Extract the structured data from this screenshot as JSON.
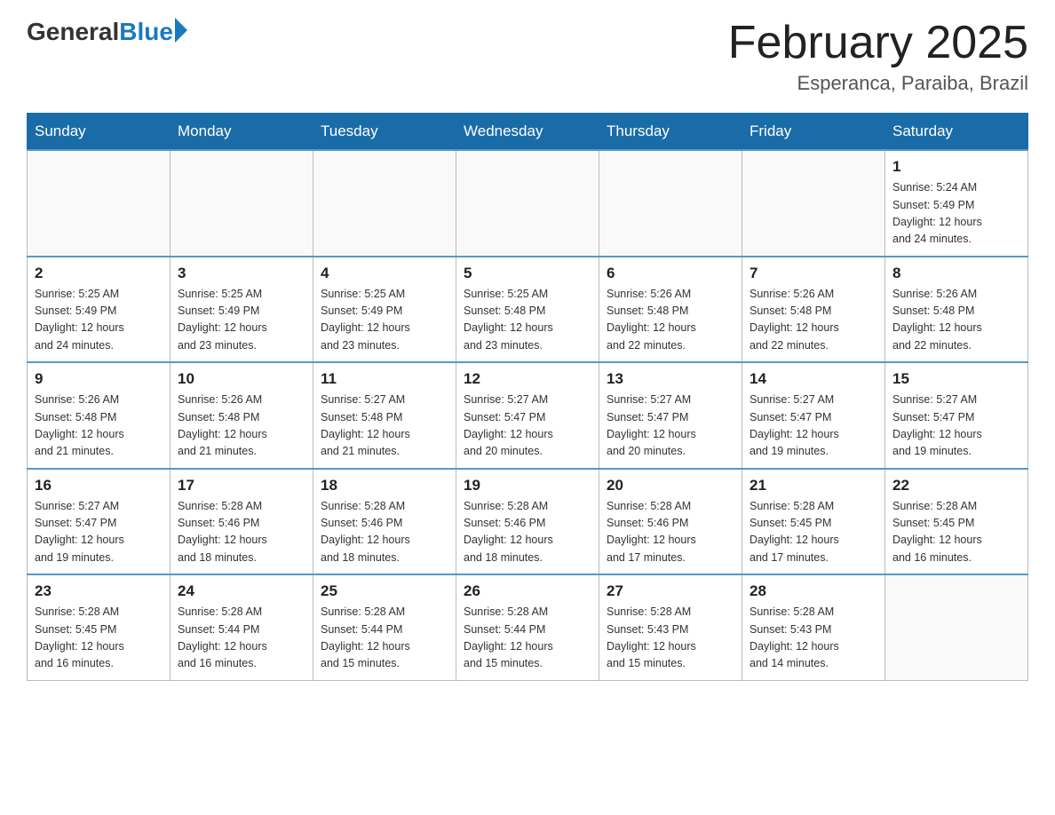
{
  "header": {
    "logo_general": "General",
    "logo_blue": "Blue",
    "month_title": "February 2025",
    "location": "Esperanca, Paraiba, Brazil"
  },
  "days_of_week": [
    "Sunday",
    "Monday",
    "Tuesday",
    "Wednesday",
    "Thursday",
    "Friday",
    "Saturday"
  ],
  "weeks": [
    [
      {
        "day": "",
        "info": ""
      },
      {
        "day": "",
        "info": ""
      },
      {
        "day": "",
        "info": ""
      },
      {
        "day": "",
        "info": ""
      },
      {
        "day": "",
        "info": ""
      },
      {
        "day": "",
        "info": ""
      },
      {
        "day": "1",
        "info": "Sunrise: 5:24 AM\nSunset: 5:49 PM\nDaylight: 12 hours\nand 24 minutes."
      }
    ],
    [
      {
        "day": "2",
        "info": "Sunrise: 5:25 AM\nSunset: 5:49 PM\nDaylight: 12 hours\nand 24 minutes."
      },
      {
        "day": "3",
        "info": "Sunrise: 5:25 AM\nSunset: 5:49 PM\nDaylight: 12 hours\nand 23 minutes."
      },
      {
        "day": "4",
        "info": "Sunrise: 5:25 AM\nSunset: 5:49 PM\nDaylight: 12 hours\nand 23 minutes."
      },
      {
        "day": "5",
        "info": "Sunrise: 5:25 AM\nSunset: 5:48 PM\nDaylight: 12 hours\nand 23 minutes."
      },
      {
        "day": "6",
        "info": "Sunrise: 5:26 AM\nSunset: 5:48 PM\nDaylight: 12 hours\nand 22 minutes."
      },
      {
        "day": "7",
        "info": "Sunrise: 5:26 AM\nSunset: 5:48 PM\nDaylight: 12 hours\nand 22 minutes."
      },
      {
        "day": "8",
        "info": "Sunrise: 5:26 AM\nSunset: 5:48 PM\nDaylight: 12 hours\nand 22 minutes."
      }
    ],
    [
      {
        "day": "9",
        "info": "Sunrise: 5:26 AM\nSunset: 5:48 PM\nDaylight: 12 hours\nand 21 minutes."
      },
      {
        "day": "10",
        "info": "Sunrise: 5:26 AM\nSunset: 5:48 PM\nDaylight: 12 hours\nand 21 minutes."
      },
      {
        "day": "11",
        "info": "Sunrise: 5:27 AM\nSunset: 5:48 PM\nDaylight: 12 hours\nand 21 minutes."
      },
      {
        "day": "12",
        "info": "Sunrise: 5:27 AM\nSunset: 5:47 PM\nDaylight: 12 hours\nand 20 minutes."
      },
      {
        "day": "13",
        "info": "Sunrise: 5:27 AM\nSunset: 5:47 PM\nDaylight: 12 hours\nand 20 minutes."
      },
      {
        "day": "14",
        "info": "Sunrise: 5:27 AM\nSunset: 5:47 PM\nDaylight: 12 hours\nand 19 minutes."
      },
      {
        "day": "15",
        "info": "Sunrise: 5:27 AM\nSunset: 5:47 PM\nDaylight: 12 hours\nand 19 minutes."
      }
    ],
    [
      {
        "day": "16",
        "info": "Sunrise: 5:27 AM\nSunset: 5:47 PM\nDaylight: 12 hours\nand 19 minutes."
      },
      {
        "day": "17",
        "info": "Sunrise: 5:28 AM\nSunset: 5:46 PM\nDaylight: 12 hours\nand 18 minutes."
      },
      {
        "day": "18",
        "info": "Sunrise: 5:28 AM\nSunset: 5:46 PM\nDaylight: 12 hours\nand 18 minutes."
      },
      {
        "day": "19",
        "info": "Sunrise: 5:28 AM\nSunset: 5:46 PM\nDaylight: 12 hours\nand 18 minutes."
      },
      {
        "day": "20",
        "info": "Sunrise: 5:28 AM\nSunset: 5:46 PM\nDaylight: 12 hours\nand 17 minutes."
      },
      {
        "day": "21",
        "info": "Sunrise: 5:28 AM\nSunset: 5:45 PM\nDaylight: 12 hours\nand 17 minutes."
      },
      {
        "day": "22",
        "info": "Sunrise: 5:28 AM\nSunset: 5:45 PM\nDaylight: 12 hours\nand 16 minutes."
      }
    ],
    [
      {
        "day": "23",
        "info": "Sunrise: 5:28 AM\nSunset: 5:45 PM\nDaylight: 12 hours\nand 16 minutes."
      },
      {
        "day": "24",
        "info": "Sunrise: 5:28 AM\nSunset: 5:44 PM\nDaylight: 12 hours\nand 16 minutes."
      },
      {
        "day": "25",
        "info": "Sunrise: 5:28 AM\nSunset: 5:44 PM\nDaylight: 12 hours\nand 15 minutes."
      },
      {
        "day": "26",
        "info": "Sunrise: 5:28 AM\nSunset: 5:44 PM\nDaylight: 12 hours\nand 15 minutes."
      },
      {
        "day": "27",
        "info": "Sunrise: 5:28 AM\nSunset: 5:43 PM\nDaylight: 12 hours\nand 15 minutes."
      },
      {
        "day": "28",
        "info": "Sunrise: 5:28 AM\nSunset: 5:43 PM\nDaylight: 12 hours\nand 14 minutes."
      },
      {
        "day": "",
        "info": ""
      }
    ]
  ]
}
